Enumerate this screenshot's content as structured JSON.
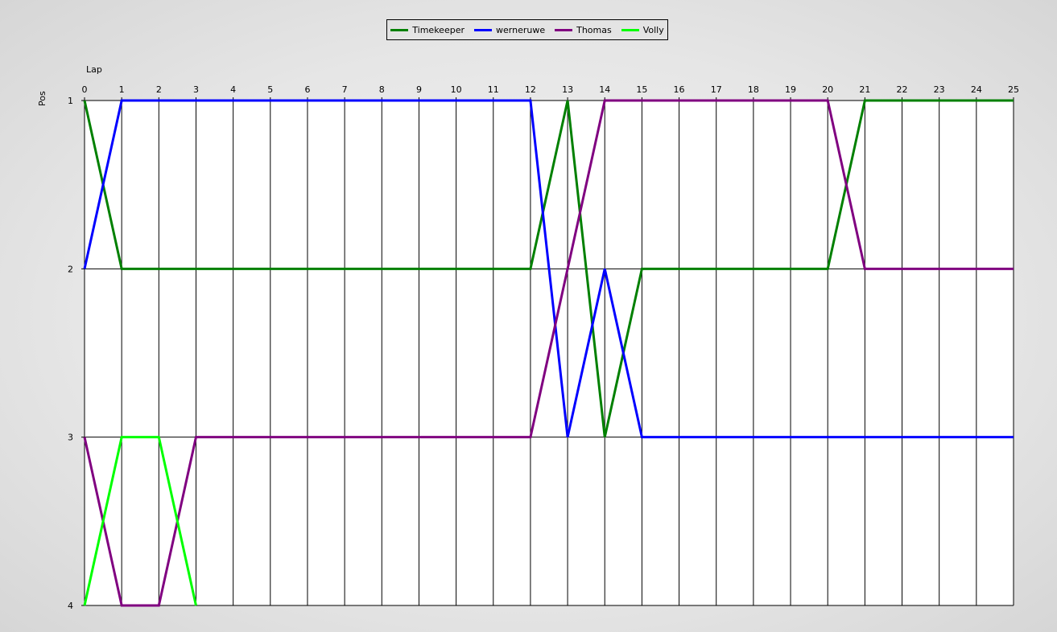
{
  "chart_data": {
    "type": "line",
    "title": "",
    "xlabel": "Lap",
    "ylabel": "Pos",
    "xlim": [
      0,
      25
    ],
    "ylim": [
      1,
      4
    ],
    "y_inverted": true,
    "x_axis_position": "top",
    "grid": true,
    "legend_placement": "top-center",
    "x": [
      0,
      1,
      2,
      3,
      4,
      5,
      6,
      7,
      8,
      9,
      10,
      11,
      12,
      13,
      14,
      15,
      16,
      17,
      18,
      19,
      20,
      21,
      22,
      23,
      24,
      25
    ],
    "y_ticks": [
      1,
      2,
      3,
      4
    ],
    "series": [
      {
        "name": "Timekeeper",
        "color": "#008000",
        "values": [
          1,
          2,
          2,
          2,
          2,
          2,
          2,
          2,
          2,
          2,
          2,
          2,
          2,
          1,
          3,
          2,
          2,
          2,
          2,
          2,
          2,
          1,
          1,
          1,
          1,
          1
        ]
      },
      {
        "name": "werneruwe",
        "color": "#0000ff",
        "values": [
          2,
          1,
          1,
          1,
          1,
          1,
          1,
          1,
          1,
          1,
          1,
          1,
          1,
          3,
          2,
          3,
          3,
          3,
          3,
          3,
          3,
          3,
          3,
          3,
          3,
          3
        ]
      },
      {
        "name": "Thomas",
        "color": "#800080",
        "values": [
          3,
          4,
          4,
          3,
          3,
          3,
          3,
          3,
          3,
          3,
          3,
          3,
          3,
          2,
          1,
          1,
          1,
          1,
          1,
          1,
          1,
          2,
          2,
          2,
          2,
          2
        ]
      },
      {
        "name": "Volly",
        "color": "#00ff00",
        "values": [
          4,
          3,
          3,
          4
        ]
      }
    ]
  }
}
